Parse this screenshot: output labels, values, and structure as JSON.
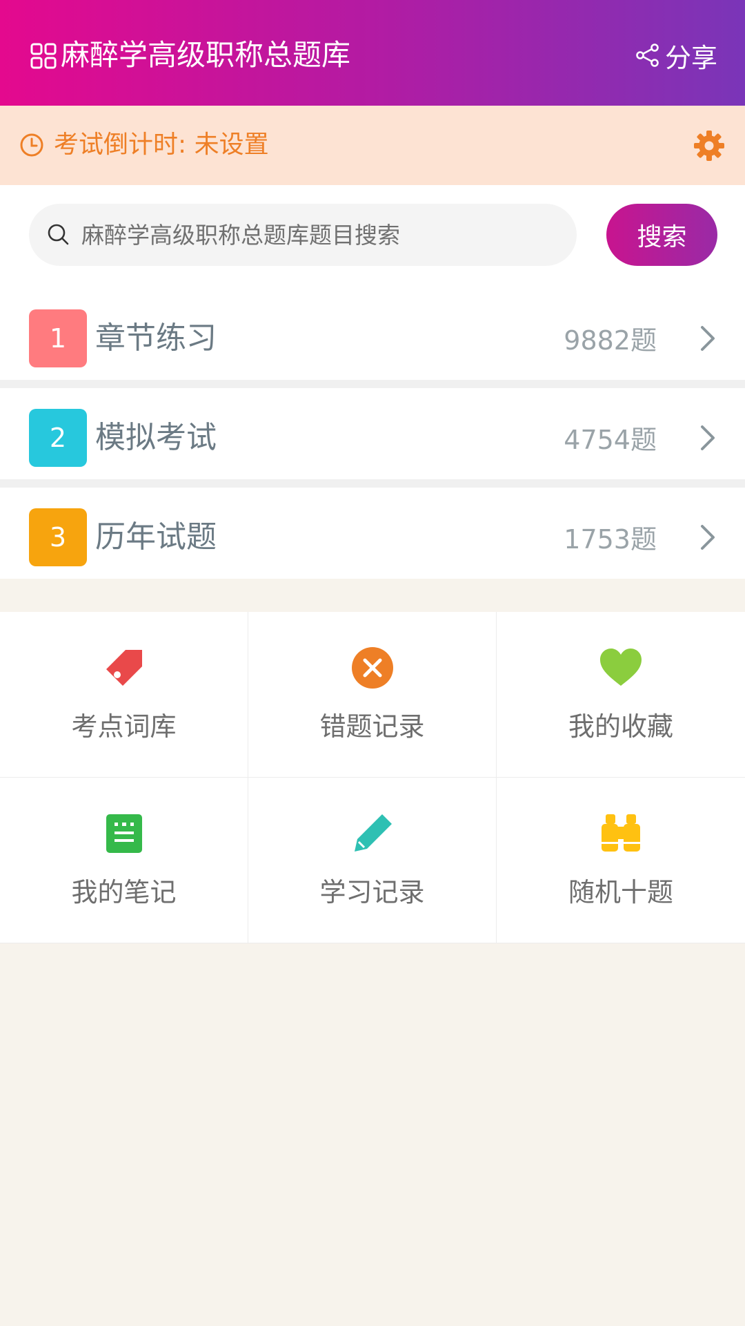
{
  "header": {
    "title": "麻醉学高级职称总题库",
    "share_label": "分享"
  },
  "countdown": {
    "text": "考试倒计时: 未设置",
    "color": "#ee7f26"
  },
  "search": {
    "placeholder": "麻醉学高级职称总题库题目搜索",
    "button_label": "搜索"
  },
  "menu": [
    {
      "index": "1",
      "label": "章节练习",
      "count": "9882题",
      "color": "#ff7b7f"
    },
    {
      "index": "2",
      "label": "模拟考试",
      "count": "4754题",
      "color": "#27c8dd"
    },
    {
      "index": "3",
      "label": "历年试题",
      "count": "1753题",
      "color": "#f7a40e"
    }
  ],
  "tools": [
    {
      "label": "考点词库",
      "icon": "tag-icon",
      "color": "#e9494a"
    },
    {
      "label": "错题记录",
      "icon": "x-circle-icon",
      "color": "#ee7f26"
    },
    {
      "label": "我的收藏",
      "icon": "heart-icon",
      "color": "#8bcd3e"
    },
    {
      "label": "我的笔记",
      "icon": "notepad-icon",
      "color": "#35b94a"
    },
    {
      "label": "学习记录",
      "icon": "pencil-icon",
      "color": "#2ec0b3"
    },
    {
      "label": "随机十题",
      "icon": "binoculars-icon",
      "color": "#ffc111"
    }
  ]
}
